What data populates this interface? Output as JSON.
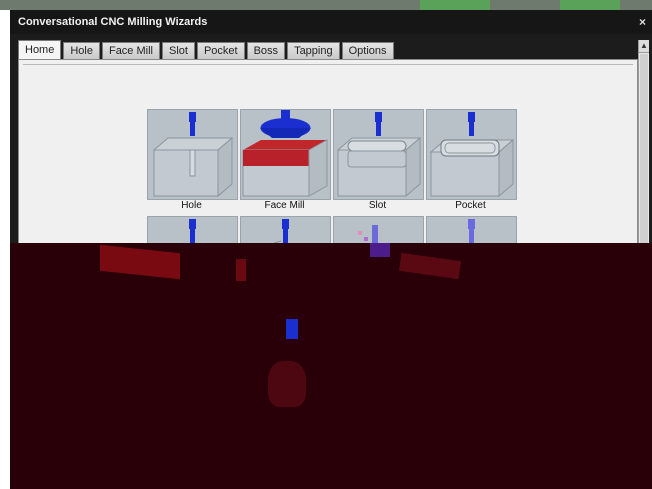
{
  "window": {
    "title": "Conversational CNC Milling Wizards",
    "close_glyph": "×"
  },
  "tabs": [
    {
      "label": "Home",
      "active": true
    },
    {
      "label": "Hole"
    },
    {
      "label": "Face Mill"
    },
    {
      "label": "Slot"
    },
    {
      "label": "Pocket"
    },
    {
      "label": "Boss"
    },
    {
      "label": "Tapping"
    },
    {
      "label": "Options"
    }
  ],
  "wizards": [
    {
      "label": "Hole",
      "icon": "hole-operation-icon"
    },
    {
      "label": "Face Mill",
      "icon": "face-mill-operation-icon"
    },
    {
      "label": "Slot",
      "icon": "slot-operation-icon"
    },
    {
      "label": "Pocket",
      "icon": "pocket-operation-icon"
    }
  ],
  "colors": {
    "tool_blue": "#1b2fd0",
    "face_red": "#c0262a",
    "card_bg": "#b8c0c8",
    "overlay": "#2a0008"
  }
}
